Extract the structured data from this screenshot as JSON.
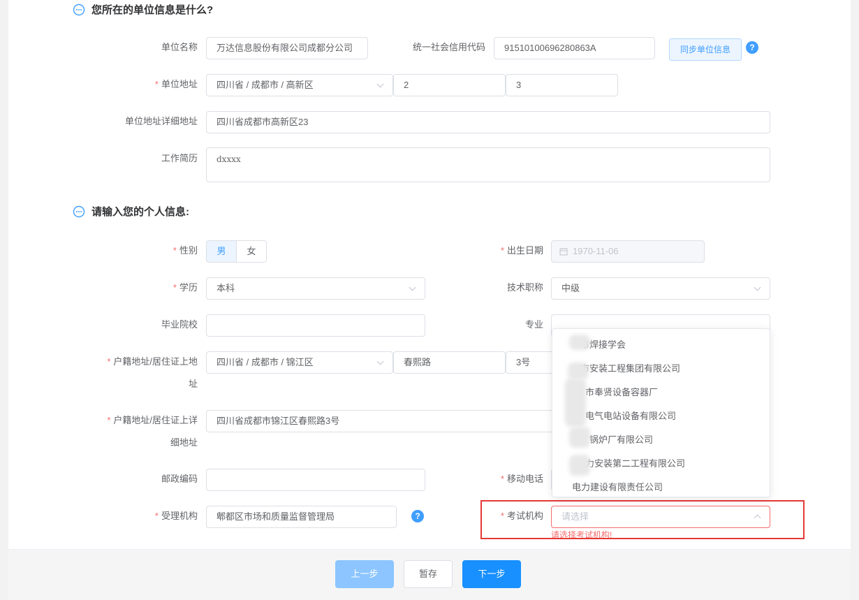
{
  "section_company": {
    "title": "您所在的单位信息是什么?"
  },
  "company": {
    "name_label": "单位名称",
    "name_value": "万达信息股份有限公司成都分公司",
    "credit_label": "统一社会信用代码",
    "credit_value": "91510100696280863A",
    "sync_button": "同步单位信息",
    "help": "?",
    "address_label": "单位地址",
    "address_region": "四川省 / 成都市 / 高新区",
    "address_part2": "2",
    "address_part3": "3",
    "detail_label": "单位地址详细地址",
    "detail_value": "四川省成都市高新区23",
    "resume_label": "工作简历",
    "resume_value": "dxxxx"
  },
  "section_personal": {
    "title": "请输入您的个人信息:"
  },
  "personal": {
    "required_mark": "*",
    "gender_label": "性别",
    "gender_options": [
      "男",
      "女"
    ],
    "birth_label": "出生日期",
    "birth_value": "1970-11-06",
    "education_label": "学历",
    "education_value": "本科",
    "title_label": "技术职称",
    "title_value": "中级",
    "school_label": "毕业院校",
    "school_value": "",
    "major_label": "专业",
    "major_value": "",
    "huji_label_1": "户籍地址/居住证上地",
    "huji_label_2": "址",
    "huji_region": "四川省 / 成都市 / 锦江区",
    "huji_street": "春熙路",
    "huji_number": "3号",
    "huji_detail_label_1": "户籍地址/居住证上详",
    "huji_detail_label_2": "细地址",
    "huji_detail_value": "四川省成都市锦江区春熙路3号",
    "postcode_label": "邮政编码",
    "postcode_value": "",
    "mobile_label": "移动电话",
    "agency_label": "受理机构",
    "agency_value": "郫都区市场和质量监督管理局",
    "exam_label": "考试机构",
    "exam_placeholder": "请选择",
    "exam_error": "请选择考试机构!"
  },
  "dropdown": {
    "items": [
      "市焊接学会",
      "市安装工程集团有限公司",
      "市奉贤设备容器厂",
      "电气电站设备有限公司",
      "锅炉厂有限公司",
      "力安装第二工程有限公司",
      "电力建设有限责任公司"
    ]
  },
  "footer": {
    "prev": "上一步",
    "save": "暂存",
    "next": "下一步"
  },
  "colors": {
    "primary": "#1890ff",
    "error": "#f56c6c",
    "highlight_box": "#e53935"
  }
}
